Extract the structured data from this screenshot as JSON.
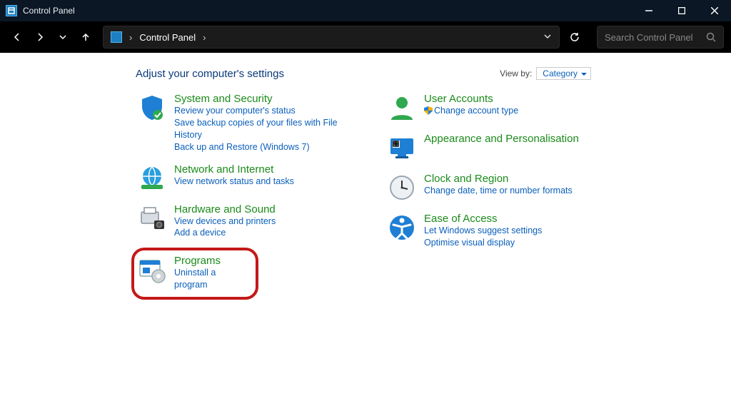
{
  "window": {
    "title": "Control Panel"
  },
  "breadcrumb": {
    "root": "Control Panel"
  },
  "search": {
    "placeholder": "Search Control Panel"
  },
  "heading": "Adjust your computer's settings",
  "viewby": {
    "label": "View by:",
    "value": "Category"
  },
  "left": [
    {
      "title": "System and Security",
      "links": [
        "Review your computer's status",
        "Save backup copies of your files with File History",
        "Back up and Restore (Windows 7)"
      ]
    },
    {
      "title": "Network and Internet",
      "links": [
        "View network status and tasks"
      ]
    },
    {
      "title": "Hardware and Sound",
      "links": [
        "View devices and printers",
        "Add a device"
      ]
    },
    {
      "title": "Programs",
      "links": [
        "Uninstall a program"
      ]
    }
  ],
  "right": [
    {
      "title": "User Accounts",
      "links": [
        "Change account type"
      ],
      "shield": true
    },
    {
      "title": "Appearance and Personalisation",
      "links": []
    },
    {
      "title": "Clock and Region",
      "links": [
        "Change date, time or number formats"
      ]
    },
    {
      "title": "Ease of Access",
      "links": [
        "Let Windows suggest settings",
        "Optimise visual display"
      ]
    }
  ]
}
